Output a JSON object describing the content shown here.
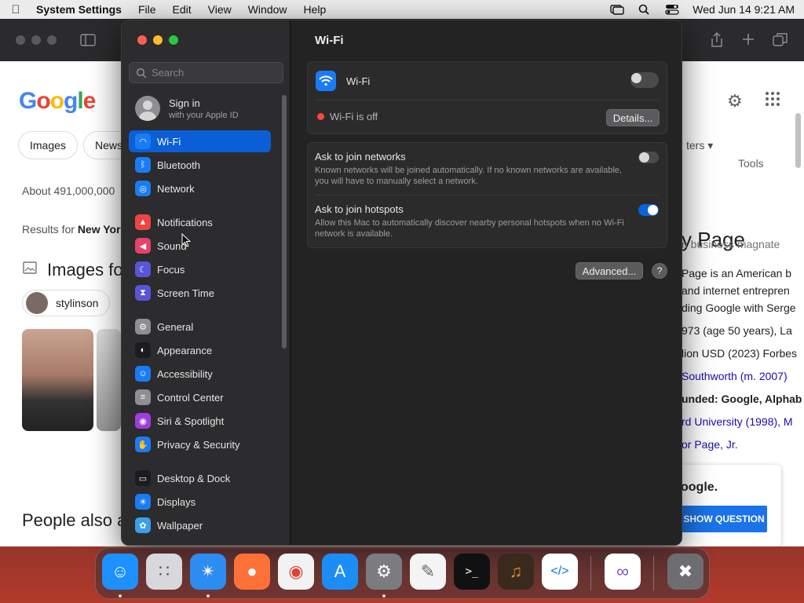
{
  "menubar": {
    "app_name": "System Settings",
    "menus": [
      "File",
      "Edit",
      "View",
      "Window",
      "Help"
    ],
    "datetime": "Wed Jun 14  9:21 AM"
  },
  "browser": {
    "logo": [
      "G",
      "o",
      "o",
      "g",
      "l",
      "e"
    ],
    "chips": [
      "Images",
      "News"
    ],
    "tools_label": "Tools",
    "filters_label": "ters",
    "result_count": "About 491,000,000",
    "results_for_prefix": "Results for ",
    "results_for_bold": "New Yor",
    "images_heading": "Images fo",
    "image_chip": "stylinson",
    "people_also": "People also a",
    "kp_title": "y Page",
    "kp_subtitle": "n business magnate",
    "kp_lines": [
      "Page is an American b",
      " and internet entrepren",
      "ding Google with Serge",
      "973 (age 50 years), La",
      "lion USD (2023) Forbes",
      "Southworth (m. 2007)",
      "unded: Google, Alphab",
      "rd University (1998), M",
      "or Page, Jr."
    ],
    "quiz_text": "oogle.",
    "quiz_button": "SHOW QUESTION"
  },
  "settings": {
    "search_placeholder": "Search",
    "account_name": "Sign in",
    "account_sub": "with your Apple ID",
    "nav": [
      {
        "label": "Wi-Fi",
        "icon": "wifi-icon",
        "color": "#1a7cf5",
        "selected": true
      },
      {
        "label": "Bluetooth",
        "icon": "bluetooth-icon",
        "color": "#1a7cf5"
      },
      {
        "label": "Network",
        "icon": "globe-icon",
        "color": "#1a7cf5"
      },
      {
        "label": "Notifications",
        "icon": "bell-icon",
        "color": "#ef4444"
      },
      {
        "label": "Sound",
        "icon": "speaker-icon",
        "color": "#e8416a"
      },
      {
        "label": "Focus",
        "icon": "moon-icon",
        "color": "#5856d6"
      },
      {
        "label": "Screen Time",
        "icon": "hourglass-icon",
        "color": "#5856d6"
      },
      {
        "label": "General",
        "icon": "gear-icon",
        "color": "#8e8e93"
      },
      {
        "label": "Appearance",
        "icon": "appearance-icon",
        "color": "#1c1c1e"
      },
      {
        "label": "Accessibility",
        "icon": "accessibility-icon",
        "color": "#1a7cf5"
      },
      {
        "label": "Control Center",
        "icon": "control-center-icon",
        "color": "#8e8e93"
      },
      {
        "label": "Siri & Spotlight",
        "icon": "siri-icon",
        "color": "#a03ce0"
      },
      {
        "label": "Privacy & Security",
        "icon": "hand-icon",
        "color": "#1a7cf5"
      },
      {
        "label": "Desktop & Dock",
        "icon": "dock-icon",
        "color": "#1c1c1e"
      },
      {
        "label": "Displays",
        "icon": "sun-icon",
        "color": "#1a7cf5"
      },
      {
        "label": "Wallpaper",
        "icon": "wallpaper-icon",
        "color": "#3aa0e8"
      }
    ],
    "pane_title": "Wi-Fi",
    "wifi_label": "Wi-Fi",
    "wifi_enabled": false,
    "wifi_status": "Wi-Fi is off",
    "details_button": "Details...",
    "ask_networks_title": "Ask to join networks",
    "ask_networks_desc": "Known networks will be joined automatically. If no known networks are available, you will have to manually select a network.",
    "ask_networks_enabled": false,
    "ask_hotspots_title": "Ask to join hotspots",
    "ask_hotspots_desc": "Allow this Mac to automatically discover nearby personal hotspots when no Wi-Fi network is available.",
    "ask_hotspots_enabled": true,
    "advanced_button": "Advanced...",
    "help_button": "?"
  },
  "dock": {
    "apps": [
      {
        "name": "finder-icon",
        "color": "#1e90ff"
      },
      {
        "name": "launchpad-icon",
        "color": "#d7d7dc"
      },
      {
        "name": "safari-icon",
        "color": "#2d8cf0"
      },
      {
        "name": "firefox-icon",
        "color": "#ff7139"
      },
      {
        "name": "chrome-icon",
        "color": "#f2f2f2"
      },
      {
        "name": "app-store-icon",
        "color": "#1c8df5"
      },
      {
        "name": "system-settings-icon",
        "color": "#7c7c80"
      },
      {
        "name": "textedit-icon",
        "color": "#f4f4f4"
      },
      {
        "name": "terminal-icon",
        "color": "#111111"
      },
      {
        "name": "garageband-icon",
        "color": "#3a2a1e"
      },
      {
        "name": "vscode-icon",
        "color": "#ffffff"
      },
      {
        "name": "visual-studio-icon",
        "color": "#ffffff"
      },
      {
        "name": "trash-icon",
        "color": "#6e6e72"
      }
    ]
  }
}
